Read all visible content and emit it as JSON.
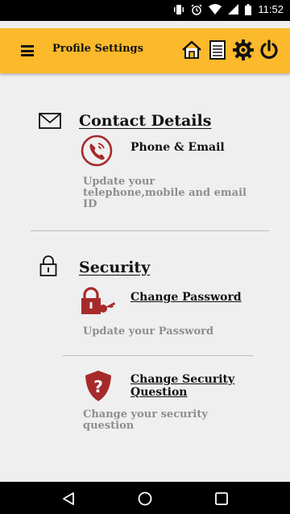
{
  "status_bar": {
    "time": "11:52"
  },
  "app_bar": {
    "title": "Profile Settings",
    "icons": [
      "menu-icon",
      "home-icon",
      "document-icon",
      "settings-gear-icon",
      "power-icon"
    ]
  },
  "contact": {
    "section_title": "Contact Details",
    "item_title": "Phone & Email",
    "item_desc_lines": [
      "Update your",
      "telephone,mobile and email",
      "ID"
    ]
  },
  "security": {
    "section_title": "Security",
    "change_password": {
      "title": "Change Password",
      "desc": "Update your Password"
    },
    "change_question": {
      "title_lines": [
        "Change Security",
        "Question"
      ],
      "desc_lines": [
        "Change your security",
        "question"
      ]
    }
  },
  "colors": {
    "accent": "#fbb92b",
    "icon_red": "#a62a2a",
    "muted_text": "#8e8e8e"
  }
}
